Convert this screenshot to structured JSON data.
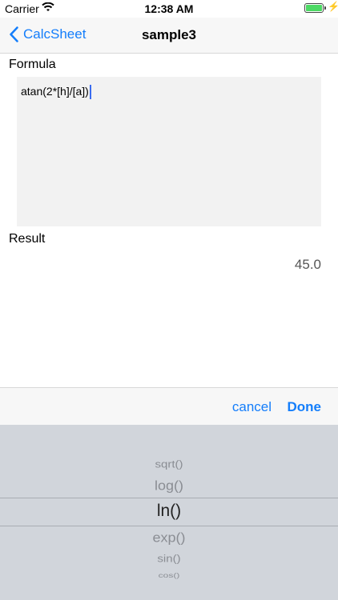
{
  "status_bar": {
    "carrier": "Carrier",
    "time": "12:38 AM"
  },
  "nav": {
    "back_label": "CalcSheet",
    "title": "sample3"
  },
  "formula": {
    "label": "Formula",
    "value": "atan(2*[h]/[a])"
  },
  "result": {
    "label": "Result",
    "value": "45.0"
  },
  "toolbar": {
    "cancel_label": "cancel",
    "done_label": "Done"
  },
  "picker": {
    "items": [
      "sqrt()",
      "log()",
      "ln()",
      "exp()",
      "sin()",
      "cos()"
    ],
    "selected": "ln()"
  },
  "colors": {
    "accent": "#147efb",
    "picker_bg": "#d1d5db",
    "battery": "#4cd964"
  }
}
